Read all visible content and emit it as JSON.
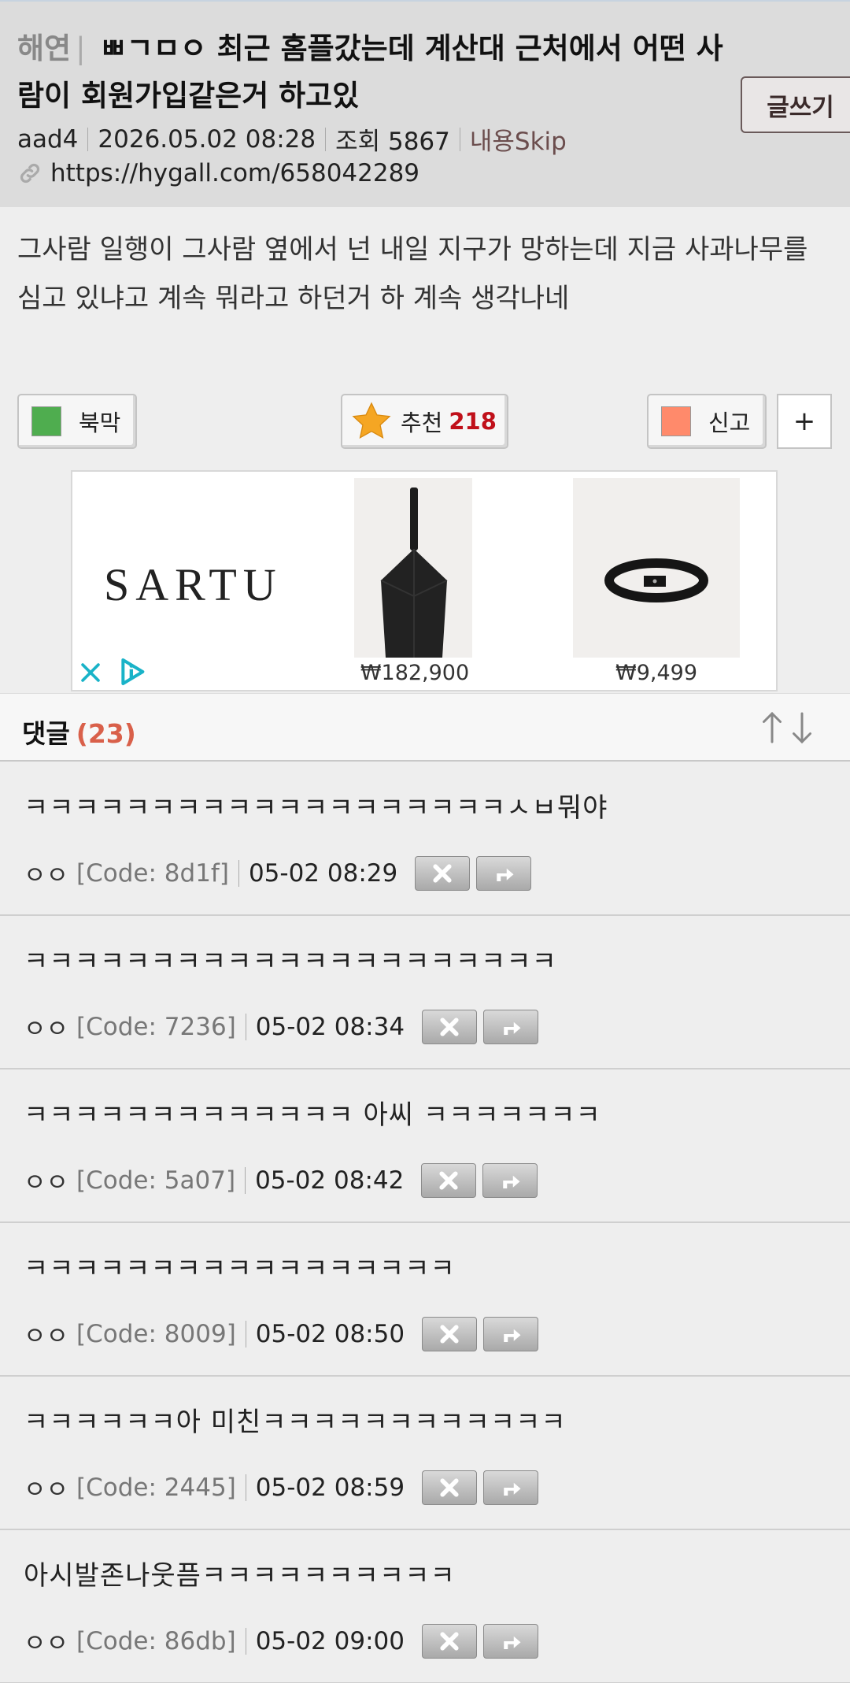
{
  "header": {
    "category": "해연",
    "title": "ㅃㄱㅁㅇ 최근 홈플갔는데 계산대 근처에서 어떤 사람이 회원가입같은거 하고있",
    "write_label": "글쓰기",
    "author": "aad4",
    "datetime": "2026.05.02 08:28",
    "views": "조회 5867",
    "skip_label": "내용Skip",
    "url": "https://hygall.com/658042289"
  },
  "content": "그사람 일행이 그사람 옆에서 넌 내일 지구가 망하는데 지금 사과나무를 심고 있냐고 계속 뭐라고 하던거 하 계속 생각나네",
  "actions": {
    "bookmark_label": "북막",
    "recommend_label": "추천",
    "recommend_count": "218",
    "report_label": "신고",
    "plus_label": "+"
  },
  "ad": {
    "brand": "SARTU",
    "price1": "₩182,900",
    "price2": "₩9,499"
  },
  "comments_header": {
    "title": "댓글",
    "count": "(23)"
  },
  "comments": [
    {
      "text": "ㅋㅋㅋㅋㅋㅋㅋㅋㅋㅋㅋㅋㅋㅋㅋㅋㅋㅋㅋㅅㅂ뭐야",
      "nick": "ㅇㅇ",
      "code": "[Code: 8d1f]",
      "time": "05-02 08:29"
    },
    {
      "text": "ㅋㅋㅋㅋㅋㅋㅋㅋㅋㅋㅋㅋㅋㅋㅋㅋㅋㅋㅋㅋㅋ",
      "nick": "ㅇㅇ",
      "code": "[Code: 7236]",
      "time": "05-02 08:34"
    },
    {
      "text": "ㅋㅋㅋㅋㅋㅋㅋㅋㅋㅋㅋㅋㅋ 아씨 ㅋㅋㅋㅋㅋㅋㅋ",
      "nick": "ㅇㅇ",
      "code": "[Code: 5a07]",
      "time": "05-02 08:42"
    },
    {
      "text": "ㅋㅋㅋㅋㅋㅋㅋㅋㅋㅋㅋㅋㅋㅋㅋㅋㅋ",
      "nick": "ㅇㅇ",
      "code": "[Code: 8009]",
      "time": "05-02 08:50"
    },
    {
      "text": "ㅋㅋㅋㅋㅋㅋ아 미친ㅋㅋㅋㅋㅋㅋㅋㅋㅋㅋㅋㅋ",
      "nick": "ㅇㅇ",
      "code": "[Code: 2445]",
      "time": "05-02 08:59"
    },
    {
      "text": "아시발존나웃픔ㅋㅋㅋㅋㅋㅋㅋㅋㅋㅋ",
      "nick": "ㅇㅇ",
      "code": "[Code: 86db]",
      "time": "05-02 09:00"
    }
  ]
}
